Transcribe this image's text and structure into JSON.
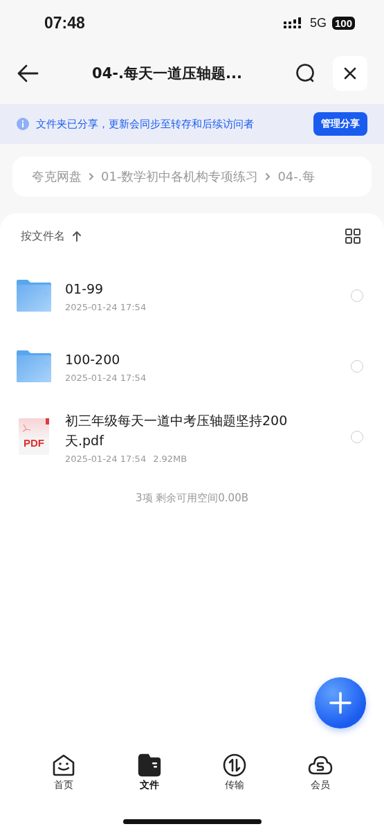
{
  "status_bar": {
    "time": "07:48",
    "network": "5G",
    "battery": "100"
  },
  "header": {
    "title": "04-.每天一道压轴题..."
  },
  "share_banner": {
    "text": "文件夹已分享，更新会同步至转存和后续访问者",
    "button": "管理分享"
  },
  "breadcrumb": [
    "夸克网盘",
    "01-数学初中各机构专项练习",
    "04-.每"
  ],
  "sort": {
    "label": "按文件名"
  },
  "files": [
    {
      "kind": "folder",
      "name": "01-99",
      "date": "2025-01-24 17:54",
      "checked": false
    },
    {
      "kind": "folder",
      "name": "100-200",
      "date": "2025-01-24 17:54",
      "checked": false
    },
    {
      "kind": "pdf",
      "badge": "PDF",
      "name": "初三年级每天一道中考压轴题坚持200天.pdf",
      "date": "2025-01-24 17:54",
      "size": "2.92MB",
      "checked": false
    }
  ],
  "summary": "3项 剩余可用空间0.00B",
  "tabs": [
    {
      "kind": "home",
      "label": "首页",
      "selected": false
    },
    {
      "kind": "files",
      "label": "文件",
      "selected": true
    },
    {
      "kind": "transfer",
      "label": "传输",
      "selected": false
    },
    {
      "kind": "member",
      "label": "会员",
      "selected": false
    }
  ]
}
